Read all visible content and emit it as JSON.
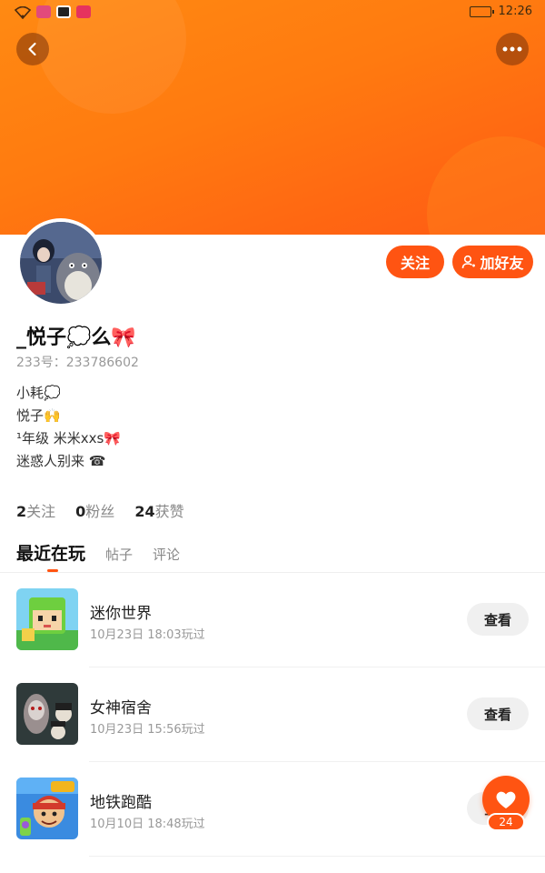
{
  "status_bar": {
    "time": "12:26"
  },
  "profile": {
    "nickname": "_悦子💭么🎀",
    "uid": "233号：233786602",
    "bio": [
      "小耗💭",
      "悦子🙌",
      "¹年级 米米xxs🎀",
      "迷惑人别来 ☎"
    ],
    "stats": [
      {
        "value": "2",
        "label": "关注"
      },
      {
        "value": "0",
        "label": "粉丝"
      },
      {
        "value": "24",
        "label": "获赞"
      }
    ]
  },
  "actions": {
    "follow_label": "关注",
    "add_friend_label": "加好友"
  },
  "tabs": [
    {
      "label": "最近在玩",
      "active": true
    },
    {
      "label": "帖子",
      "active": false
    },
    {
      "label": "评论",
      "active": false
    }
  ],
  "games": [
    {
      "title": "迷你世界",
      "time": "10月23日 18:03玩过",
      "button": "查看"
    },
    {
      "title": "女神宿舍",
      "time": "10月23日 15:56玩过",
      "button": "查看"
    },
    {
      "title": "地铁跑酷",
      "time": "10月10日 18:48玩过",
      "button": "查看"
    }
  ],
  "like": {
    "count": "24"
  },
  "colors": {
    "accent": "#ff5412",
    "banner_start": "#ff8a12",
    "banner_end": "#ff5a14"
  }
}
